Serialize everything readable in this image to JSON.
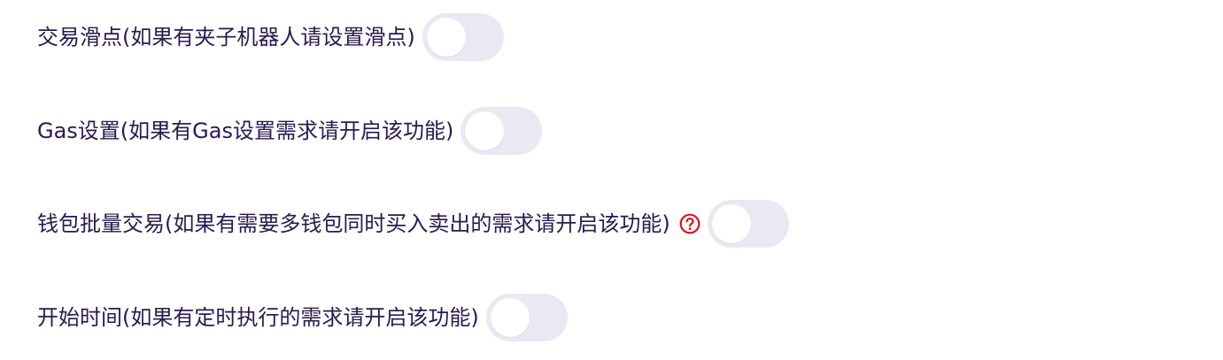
{
  "settings": [
    {
      "label": "交易滑点(如果有夹子机器人请设置滑点)",
      "enabled": false
    },
    {
      "label": "Gas设置(如果有Gas设置需求请开启该功能)",
      "enabled": false
    },
    {
      "label": "钱包批量交易(如果有需要多钱包同时买入卖出的需求请开启该功能)",
      "enabled": false,
      "has_help_icon": true
    },
    {
      "label": "开始时间(如果有定时执行的需求请开启该功能)",
      "enabled": false
    }
  ],
  "colors": {
    "label_text": "#2a1a4e",
    "toggle_track_off": "#ebe8f4",
    "toggle_knob": "#ffffff",
    "help_icon": "#e0101e"
  },
  "icons": {
    "help": "question-circle-icon"
  }
}
